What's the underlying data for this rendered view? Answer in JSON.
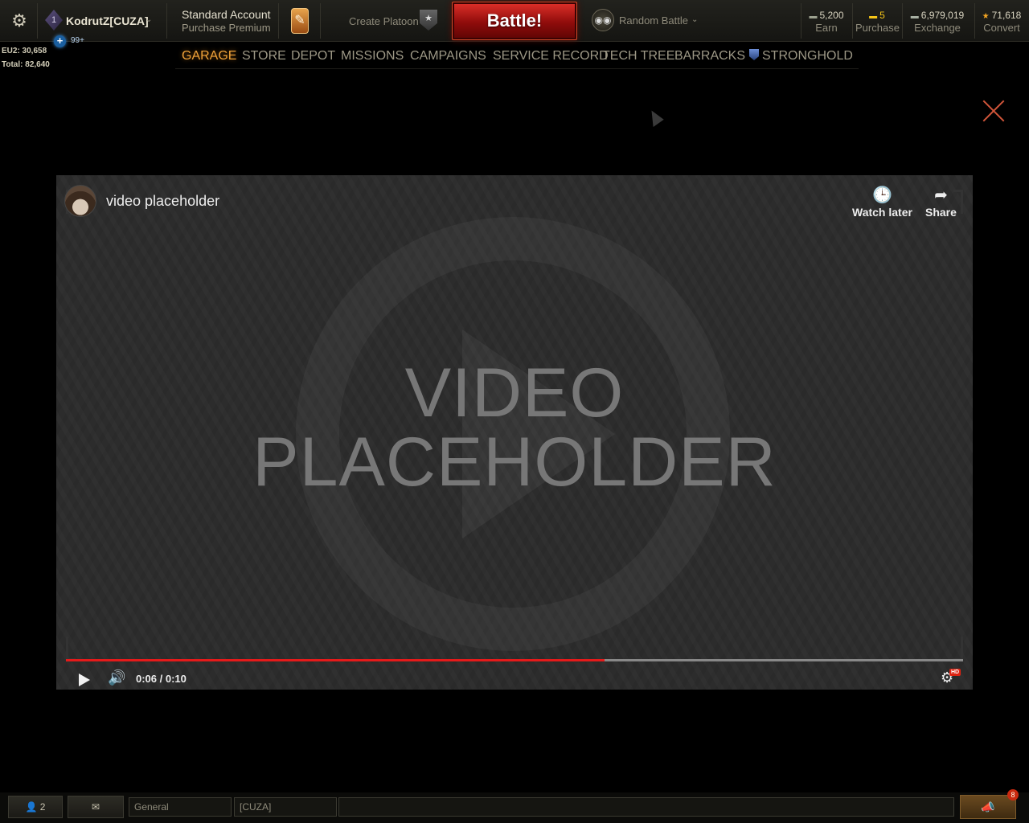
{
  "topbar": {
    "settings_icon": "⚙",
    "player": {
      "rank": "1",
      "name": "KodrutZ[CUZA]",
      "caret": "⌄",
      "plus_icon": "+",
      "notifications": "99+"
    },
    "account": {
      "type": "Standard Account",
      "action": "Purchase Premium"
    },
    "shop_icon": "✎",
    "platoon": {
      "label": "Create Platoon",
      "icon": "★"
    },
    "battle": {
      "label": "Battle!"
    },
    "battle_type": {
      "icon": "◉◉",
      "label": "Random Battle",
      "caret": "⌄"
    },
    "currencies": [
      {
        "icon": "▬",
        "value": "5,200",
        "action": "Earn",
        "color": "#9ca18f"
      },
      {
        "icon": "▬",
        "value": "5",
        "action": "Purchase",
        "color": "#f5c518"
      },
      {
        "icon": "▬",
        "value": "6,979,019",
        "action": "Exchange",
        "color": "#a9b1a4"
      },
      {
        "icon": "★",
        "value": "71,618",
        "action": "Convert",
        "color": "#f5a623"
      }
    ]
  },
  "stats": {
    "region_label": "EU2: 30,658",
    "total_label": "Total: 82,640"
  },
  "nav": {
    "items": [
      "GARAGE",
      "STORE",
      "DEPOT",
      "MISSIONS",
      "CAMPAIGNS",
      "SERVICE RECORD",
      "TECH TREE",
      "BARRACKS",
      "STRONGHOLD"
    ],
    "active": "GARAGE"
  },
  "video": {
    "title": "video placeholder",
    "placeholder_line1": "VIDEO",
    "placeholder_line2": "PLACEHOLDER",
    "watch_later": "Watch later",
    "share": "Share",
    "watch_later_icon": "🕒",
    "share_icon": "➦",
    "time": "0:06 / 0:10",
    "progress": 0.6,
    "volume_icon": "🔊",
    "settings_icon": "⚙",
    "hd_badge": "HD"
  },
  "bottombar": {
    "friends_icon": "👤",
    "friends_count": "2",
    "chat_icon": "✉",
    "channel_general": "General",
    "channel_clan": "[CUZA]",
    "notif_icon": "📣",
    "notif_count": "8"
  },
  "colors": {
    "accent": "#f0a33a",
    "battle": "#c01b14",
    "progress": "#e51a1a"
  }
}
